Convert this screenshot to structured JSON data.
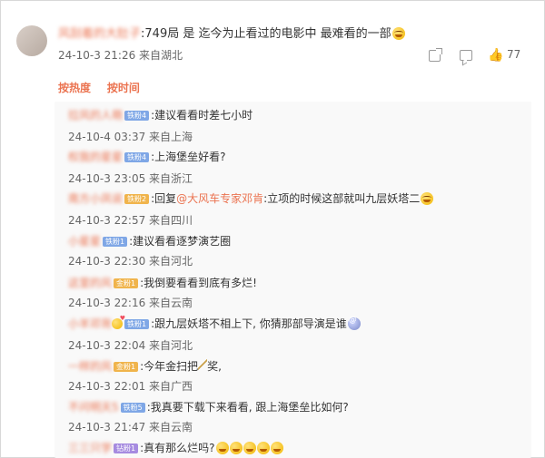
{
  "main_comment": {
    "username": "风刮着的大肚子",
    "text_suffix": ":749局 是 迄今为止看过的电影中 最难看的一部",
    "time": "24-10-3 21:26 来自湖北",
    "like_count": "77"
  },
  "sort_tabs": [
    "按热度",
    "按时间"
  ],
  "replies": [
    {
      "user": "拉风的人萌",
      "badge": "铁粉4",
      "text": ":建议看看时差七小时",
      "meta": "24-10-4 03:37 来自上海"
    },
    {
      "user": "权我的星星",
      "badge": "铁粉4",
      "text": ":上海堡垒好看?",
      "meta": "24-10-3 23:05 来自浙江"
    },
    {
      "user": "南方小凤说",
      "badge": "铁粉2",
      "text_prefix": ":回复",
      "mention": "@大风车专家邓肯",
      "text": ":立项的时候这部就叫九层妖塔二",
      "meta": "24-10-3 22:57 来自四川"
    },
    {
      "user": "小星星",
      "badge": "铁粉1",
      "text": ":建议看看逐梦演艺圈",
      "meta": "24-10-3 22:30 来自河北"
    },
    {
      "user": "这里的风",
      "badge": "金粉1",
      "text": ":我倒要看看到底有多烂!",
      "meta": "24-10-3 22:16 来自云南"
    },
    {
      "user": "小羊邓背",
      "badge": "铁粉1",
      "text": ":跟九层妖塔不相上下, 你猜那部导演是谁",
      "meta": "24-10-3 22:04 来自河北"
    },
    {
      "user": "一样的风",
      "badge": "金粉1",
      "text_prefix": ":今年金扫把",
      "text": "奖,",
      "meta": "24-10-3 22:01 来自广西"
    },
    {
      "user": "不问明天5",
      "badge": "铁粉5",
      "text": ":我真要下载下来看看, 跟上海堡垒比如何?",
      "meta": "24-10-3 21:47 来自云南"
    },
    {
      "user": "三三只学",
      "badge": "钻粉1",
      "text": ":真有那么烂吗?",
      "meta": ""
    }
  ]
}
